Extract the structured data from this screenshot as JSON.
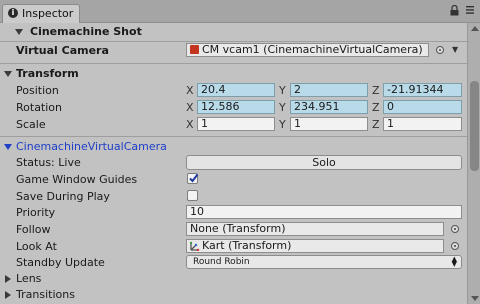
{
  "tab": {
    "title": "Inspector"
  },
  "cinemachine_shot": {
    "header": "Cinemachine Shot",
    "virtual_camera_label": "Virtual Camera",
    "virtual_camera_value": "CM vcam1 (CinemachineVirtualCamera)"
  },
  "transform": {
    "header": "Transform",
    "position": {
      "label": "Position",
      "x": "20.4",
      "y": "2",
      "z": "-21.91344"
    },
    "rotation": {
      "label": "Rotation",
      "x": "12.586",
      "y": "234.951",
      "z": "0"
    },
    "scale": {
      "label": "Scale",
      "x": "1",
      "y": "1",
      "z": "1"
    },
    "axes": {
      "x": "X",
      "y": "Y",
      "z": "Z"
    }
  },
  "vcam": {
    "header": "CinemachineVirtualCamera",
    "status_label": "Status: Live",
    "solo_button": "Solo",
    "game_window_guides_label": "Game Window Guides",
    "game_window_guides_checked": true,
    "save_during_play_label": "Save During Play",
    "save_during_play_checked": false,
    "priority_label": "Priority",
    "priority_value": "10",
    "follow_label": "Follow",
    "follow_value": "None (Transform)",
    "look_at_label": "Look At",
    "look_at_value": "Kart (Transform)",
    "standby_update_label": "Standby Update",
    "standby_update_value": "Round Robin",
    "lens_label": "Lens",
    "transitions_label": "Transitions"
  },
  "colors": {
    "panel": "#c2c2c2",
    "tinted_field": "#b9dbe9",
    "header_blue": "#1f3fc9",
    "vcam_icon": "#c3341e"
  },
  "icons": {
    "info": "info-icon",
    "lock": "lock-icon",
    "menu": "menu-icon",
    "vcam": "cinemachine-vcam-icon",
    "kart": "transform-icon",
    "picker": "object-picker-icon"
  }
}
